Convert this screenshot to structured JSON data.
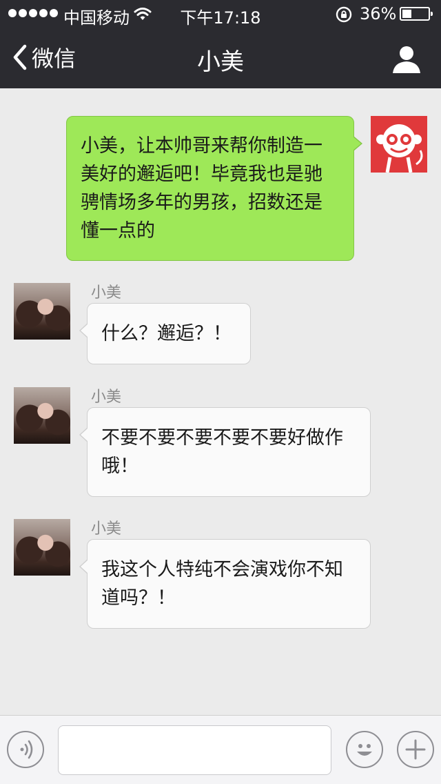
{
  "status_bar": {
    "carrier": "中国移动",
    "time": "下午17:18",
    "battery_text": "36%",
    "battery_level": 0.36,
    "signal_bars": 5
  },
  "nav": {
    "back_label": "微信",
    "title": "小美"
  },
  "messages": [
    {
      "direction": "outgoing",
      "avatar": "monkey-avatar",
      "lines": [
        "小美，让本帅哥来帮你制造一",
        "美好的邂逅吧！毕竟我也是驰",
        "骋情场多年的男孩，招数还是",
        "懂一点的"
      ]
    },
    {
      "direction": "incoming",
      "sender": "小美",
      "avatar": "girl-avatar",
      "lines": [
        "什么？邂逅？！"
      ]
    },
    {
      "direction": "incoming",
      "sender": "小美",
      "avatar": "girl-avatar",
      "lines": [
        "不要不要不要不要不要好做作",
        "哦！"
      ]
    },
    {
      "direction": "incoming",
      "sender": "小美",
      "avatar": "girl-avatar",
      "lines": [
        "我这个人特纯不会演戏你不知",
        "道吗？！"
      ]
    }
  ],
  "input_bar": {
    "text_value": "",
    "icons": [
      "voice-icon",
      "emoji-icon",
      "plus-icon"
    ]
  },
  "colors": {
    "nav_bg": "#2b2b30",
    "chat_bg": "#ebebeb",
    "outgoing_bubble": "#9ee858",
    "incoming_bubble": "#fafafa",
    "avatar_red": "#e0393b"
  }
}
